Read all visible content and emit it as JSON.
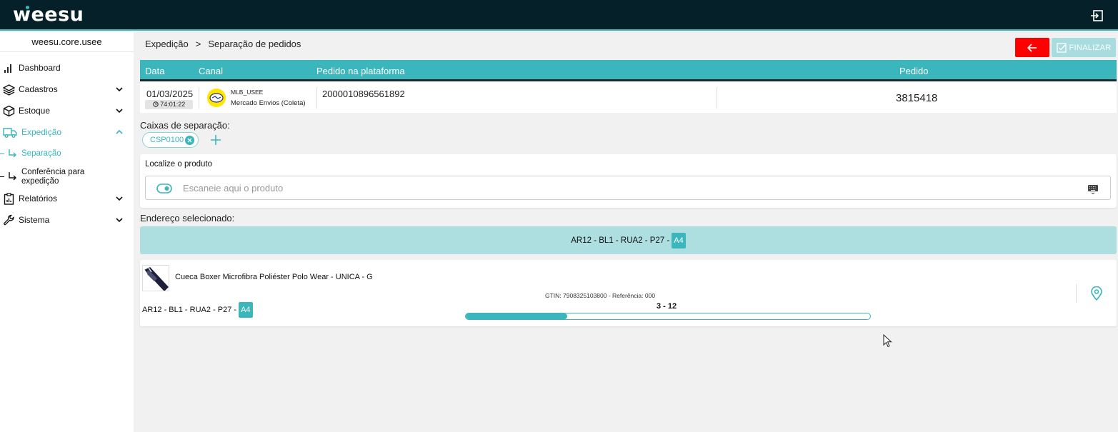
{
  "app": {
    "logo": "weesu"
  },
  "sidebar": {
    "tenant": "weesu.core.usee",
    "items": [
      {
        "label": "Dashboard",
        "icon": "bar-chart-icon"
      },
      {
        "label": "Cadastros",
        "icon": "layers-icon"
      },
      {
        "label": "Estoque",
        "icon": "box-icon"
      },
      {
        "label": "Expedição",
        "icon": "truck-icon"
      },
      {
        "label": "Relatórios",
        "icon": "clipboard-chart-icon"
      },
      {
        "label": "Sistema",
        "icon": "wrench-icon"
      }
    ],
    "subitems": [
      {
        "label": "Separação"
      },
      {
        "label": "Conferência para expedição"
      }
    ]
  },
  "breadcrumb": {
    "parent": "Expedição",
    "separator": ">",
    "current": "Separação de pedidos"
  },
  "toolbar": {
    "finish_label": "FINALIZAR"
  },
  "order": {
    "headers": {
      "data": "Data",
      "canal": "Canal",
      "pedido_plataforma": "Pedido na plataforma",
      "pedido": "Pedido"
    },
    "date": "01/03/2025",
    "elapsed": "74:01:22",
    "channel_code": "MLB_USEE",
    "channel_name": "Mercado Envios (Coleta)",
    "platform_order": "2000010896561892",
    "order_number": "3815418"
  },
  "boxes": {
    "label": "Caixas de separação:",
    "items": [
      "CSP0100"
    ]
  },
  "locate": {
    "title": "Localize o produto",
    "placeholder": "Escaneie aqui o produto",
    "value": ""
  },
  "address": {
    "label": "Endereço selecionado:",
    "path": "AR12 - BL1 - RUA2 - P27 -",
    "slot": "A4"
  },
  "product": {
    "name": "Cueca Boxer Microfibra Poliéster Polo Wear - UNICA - G",
    "gtin_line": "GTIN: 7908325103800 - Referência: 000",
    "address_path": "AR12 - BL1 - RUA2 - P27 -",
    "address_slot": "A4",
    "quantity_label": "3 - 12",
    "picked": 3,
    "total": 12
  },
  "colors": {
    "accent": "#3bb6bd",
    "topbar": "#052028",
    "danger": "#ff0000",
    "accent_light": "#addee0"
  }
}
